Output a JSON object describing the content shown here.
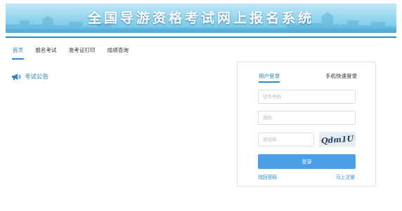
{
  "header": {
    "title": "全国导游资格考试网上报名系统"
  },
  "nav": {
    "items": [
      {
        "label": "首页",
        "active": true
      },
      {
        "label": "报名考试",
        "active": false
      },
      {
        "label": "准考证打印",
        "active": false
      },
      {
        "label": "成绩查询",
        "active": false
      }
    ]
  },
  "notice": {
    "icon": "megaphone-icon",
    "label": "考试公告"
  },
  "login": {
    "tabs": {
      "user_login": "用户登录",
      "phone_login": "手机快速登录"
    },
    "id_field": {
      "placeholder": "证件号码",
      "value": ""
    },
    "password_field": {
      "placeholder": "密码",
      "value": ""
    },
    "captcha_field": {
      "placeholder": "验证码",
      "value": ""
    },
    "captcha_text": "Qdm1U",
    "login_button": "登录",
    "forgot_password": "找回密码",
    "register": "马上注册"
  },
  "colors": {
    "accent": "#2f86c8",
    "button": "#4a9fe6",
    "header_rule": "#1d8fcf",
    "banner_top": "#bfe8f6",
    "banner_bottom": "#6cc3e7"
  }
}
